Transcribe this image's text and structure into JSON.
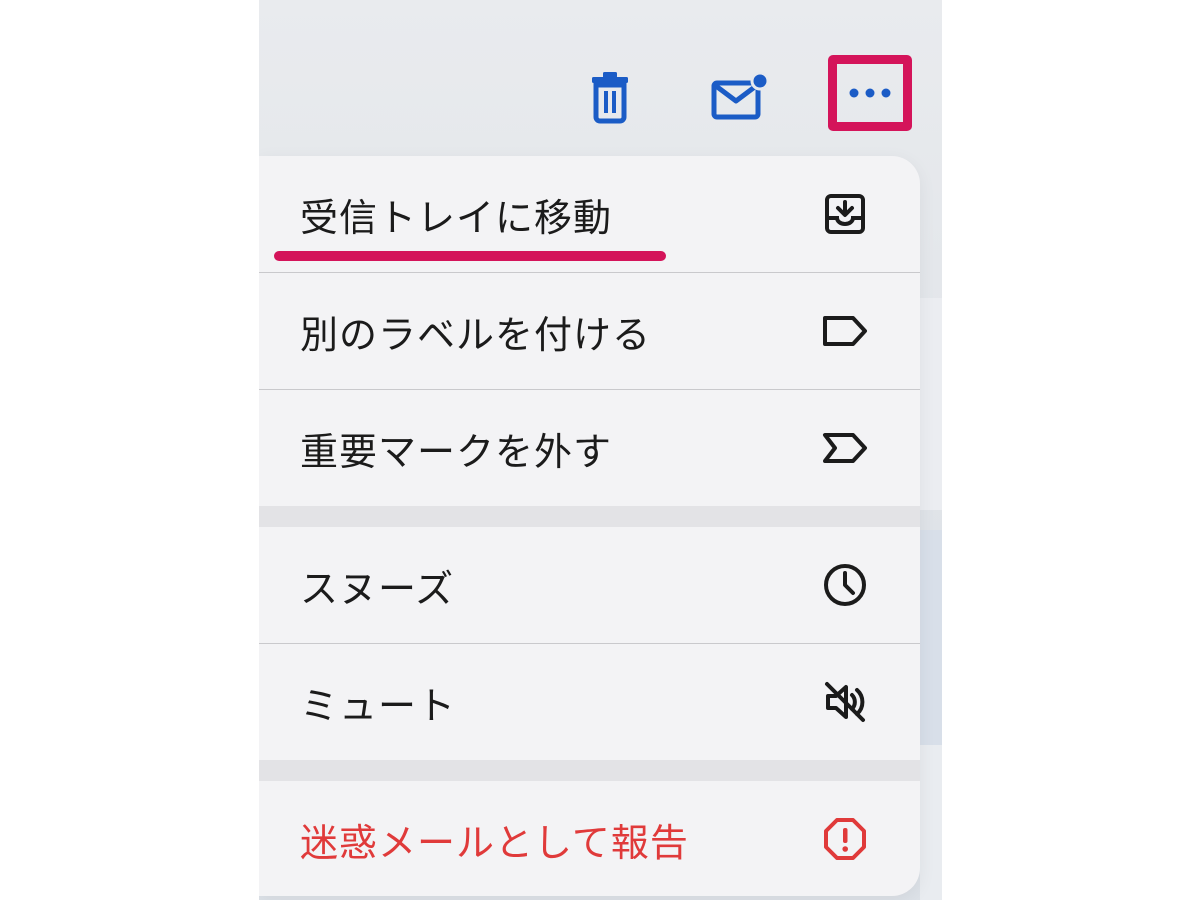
{
  "toolbar": {
    "delete_icon": "trash-icon",
    "mark_unread_icon": "mail-unread-icon",
    "more_icon": "more-horizontal-icon",
    "accent_color": "#1b5cc6",
    "highlight_color": "#d4145a"
  },
  "menu": {
    "items": [
      {
        "label": "受信トレイに移動",
        "icon": "move-to-inbox-icon"
      },
      {
        "label": "別のラベルを付ける",
        "icon": "label-icon"
      },
      {
        "label": "重要マークを外す",
        "icon": "important-mark-icon"
      },
      {
        "label": "スヌーズ",
        "icon": "clock-icon"
      },
      {
        "label": "ミュート",
        "icon": "mute-icon"
      },
      {
        "label": "迷惑メールとして報告",
        "icon": "report-spam-icon"
      }
    ],
    "danger_color": "#e03a3a"
  }
}
